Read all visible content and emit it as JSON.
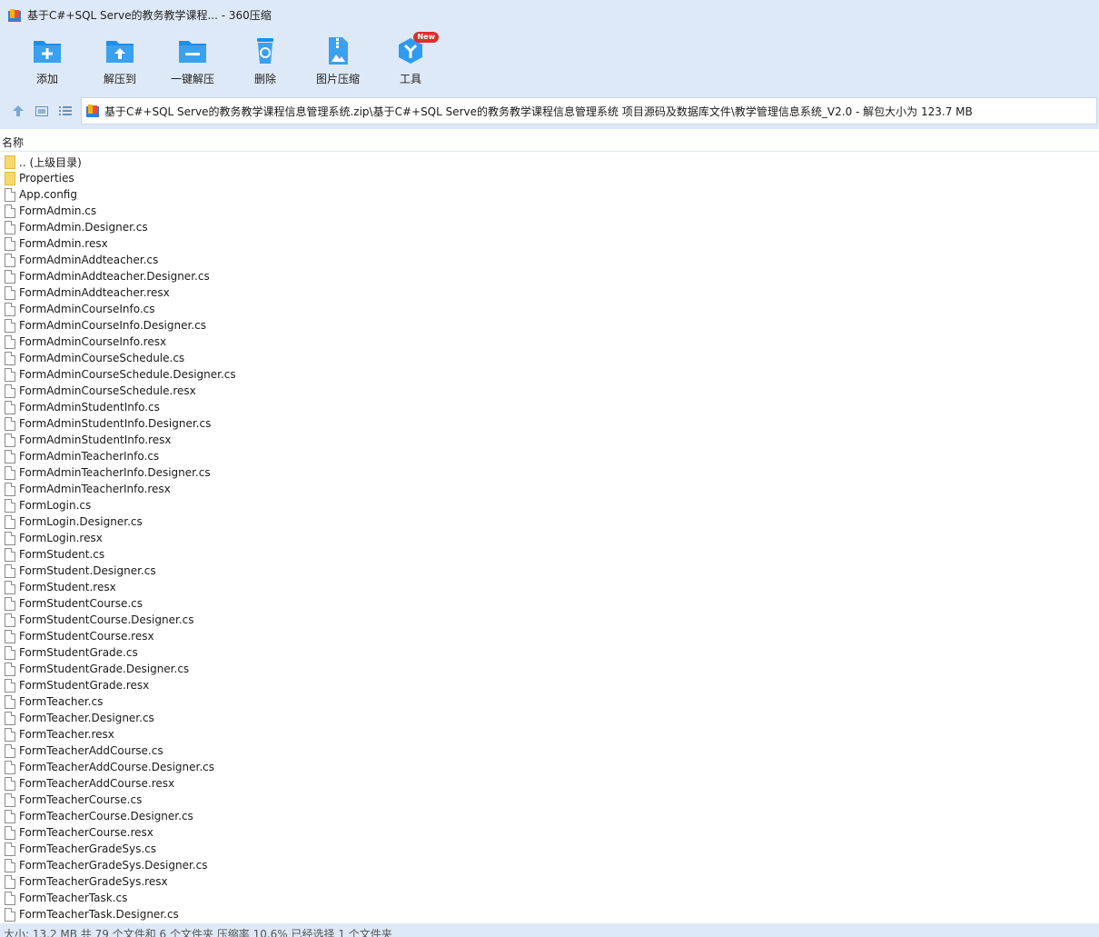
{
  "window": {
    "title": "基于C#+SQL Serve的教务教学课程... - 360压缩"
  },
  "toolbar": {
    "items": [
      {
        "label": "添加",
        "icon": "add-icon"
      },
      {
        "label": "解压到",
        "icon": "extract-to-icon"
      },
      {
        "label": "一键解压",
        "icon": "one-click-extract-icon"
      },
      {
        "label": "删除",
        "icon": "delete-icon"
      },
      {
        "label": "图片压缩",
        "icon": "image-compress-icon"
      },
      {
        "label": "工具",
        "icon": "tools-icon",
        "badge": "New"
      }
    ]
  },
  "address": {
    "path": "基于C#+SQL Serve的教务教学课程信息管理系统.zip\\基于C#+SQL Serve的教务教学课程信息管理系统 项目源码及数据库文件\\教学管理信息系统_V2.0 - 解包大小为 123.7 MB"
  },
  "list": {
    "column_name": "名称",
    "items": [
      {
        "name": ".. (上级目录)",
        "type": "folder"
      },
      {
        "name": "Properties",
        "type": "folder"
      },
      {
        "name": "App.config",
        "type": "file"
      },
      {
        "name": "FormAdmin.cs",
        "type": "file"
      },
      {
        "name": "FormAdmin.Designer.cs",
        "type": "file"
      },
      {
        "name": "FormAdmin.resx",
        "type": "file"
      },
      {
        "name": "FormAdminAddteacher.cs",
        "type": "file"
      },
      {
        "name": "FormAdminAddteacher.Designer.cs",
        "type": "file"
      },
      {
        "name": "FormAdminAddteacher.resx",
        "type": "file"
      },
      {
        "name": "FormAdminCourseInfo.cs",
        "type": "file"
      },
      {
        "name": "FormAdminCourseInfo.Designer.cs",
        "type": "file"
      },
      {
        "name": "FormAdminCourseInfo.resx",
        "type": "file"
      },
      {
        "name": "FormAdminCourseSchedule.cs",
        "type": "file"
      },
      {
        "name": "FormAdminCourseSchedule.Designer.cs",
        "type": "file"
      },
      {
        "name": "FormAdminCourseSchedule.resx",
        "type": "file"
      },
      {
        "name": "FormAdminStudentInfo.cs",
        "type": "file"
      },
      {
        "name": "FormAdminStudentInfo.Designer.cs",
        "type": "file"
      },
      {
        "name": "FormAdminStudentInfo.resx",
        "type": "file"
      },
      {
        "name": "FormAdminTeacherInfo.cs",
        "type": "file"
      },
      {
        "name": "FormAdminTeacherInfo.Designer.cs",
        "type": "file"
      },
      {
        "name": "FormAdminTeacherInfo.resx",
        "type": "file"
      },
      {
        "name": "FormLogin.cs",
        "type": "file"
      },
      {
        "name": "FormLogin.Designer.cs",
        "type": "file"
      },
      {
        "name": "FormLogin.resx",
        "type": "file"
      },
      {
        "name": "FormStudent.cs",
        "type": "file"
      },
      {
        "name": "FormStudent.Designer.cs",
        "type": "file"
      },
      {
        "name": "FormStudent.resx",
        "type": "file"
      },
      {
        "name": "FormStudentCourse.cs",
        "type": "file"
      },
      {
        "name": "FormStudentCourse.Designer.cs",
        "type": "file"
      },
      {
        "name": "FormStudentCourse.resx",
        "type": "file"
      },
      {
        "name": "FormStudentGrade.cs",
        "type": "file"
      },
      {
        "name": "FormStudentGrade.Designer.cs",
        "type": "file"
      },
      {
        "name": "FormStudentGrade.resx",
        "type": "file"
      },
      {
        "name": "FormTeacher.cs",
        "type": "file"
      },
      {
        "name": "FormTeacher.Designer.cs",
        "type": "file"
      },
      {
        "name": "FormTeacher.resx",
        "type": "file"
      },
      {
        "name": "FormTeacherAddCourse.cs",
        "type": "file"
      },
      {
        "name": "FormTeacherAddCourse.Designer.cs",
        "type": "file"
      },
      {
        "name": "FormTeacherAddCourse.resx",
        "type": "file"
      },
      {
        "name": "FormTeacherCourse.cs",
        "type": "file"
      },
      {
        "name": "FormTeacherCourse.Designer.cs",
        "type": "file"
      },
      {
        "name": "FormTeacherCourse.resx",
        "type": "file"
      },
      {
        "name": "FormTeacherGradeSys.cs",
        "type": "file"
      },
      {
        "name": "FormTeacherGradeSys.Designer.cs",
        "type": "file"
      },
      {
        "name": "FormTeacherGradeSys.resx",
        "type": "file"
      },
      {
        "name": "FormTeacherTask.cs",
        "type": "file"
      },
      {
        "name": "FormTeacherTask.Designer.cs",
        "type": "file"
      }
    ]
  },
  "status": {
    "text": "大小: 13.2 MB 共 79 个文件和 6 个文件夹 压缩率 10.6% 已经选择 1 个文件夹"
  },
  "colors": {
    "chrome": "#dde9f7",
    "icon_blue": "#1f8ee8",
    "badge_red": "#e02e2e"
  }
}
